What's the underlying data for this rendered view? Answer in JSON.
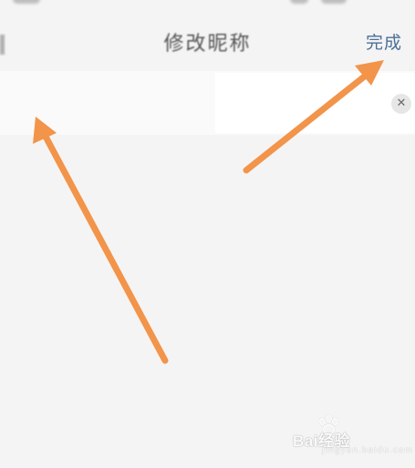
{
  "header": {
    "title": "修改昵称",
    "done_label": "完成"
  },
  "nickname_input": {
    "value": "",
    "clear_icon": "close-icon"
  },
  "hint": {
    "text": ""
  },
  "annotations": {
    "arrow_color": "#f2944a"
  },
  "watermark": {
    "text": "Bai经验",
    "sub": "jingyan.baidu.com"
  }
}
